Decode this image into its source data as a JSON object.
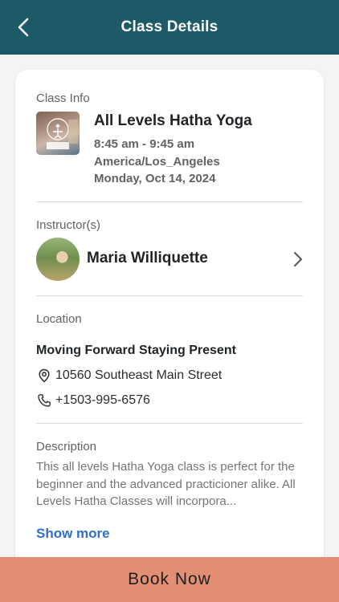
{
  "header": {
    "title": "Class Details",
    "back_icon": "chevron-left-icon"
  },
  "class_info": {
    "label": "Class Info",
    "title": "All Levels Hatha Yoga",
    "time": "8:45 am - 9:45 am",
    "timezone": "America/Los_Angeles",
    "date": "Monday, Oct 14, 2024"
  },
  "instructor": {
    "label": "Instructor(s)",
    "name": "Maria Williquette"
  },
  "location": {
    "label": "Location",
    "name": "Moving Forward Staying Present",
    "address": "10560 Southeast Main Street",
    "phone": "+1503-995-6576"
  },
  "description": {
    "label": "Description",
    "text": "This all levels Hatha Yoga class is perfect for the beginner and the advanced practicioner alike. All Levels Hatha Classes will incorpora...",
    "show_more": "Show more"
  },
  "book_button": "Book Now",
  "colors": {
    "header": "#1c5a68",
    "book": "#e28f74",
    "link": "#2f6fc9"
  }
}
